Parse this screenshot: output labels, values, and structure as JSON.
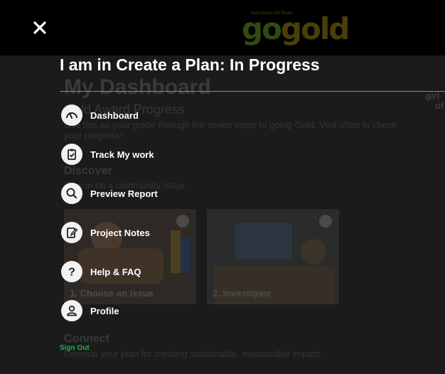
{
  "header": {
    "logo_small_text": "Gold Award Girl Scout",
    "logo_go": "go",
    "logo_gold": "gold",
    "colors": {
      "background": "#000000",
      "close": "#ffffff"
    }
  },
  "background_page": {
    "title": "My Dashboard",
    "subtitle": "Gold Award Progress",
    "intro": "Use this as your guide through the seven steps to going Gold. Visit often to check your progress!",
    "discover_heading": "Discover",
    "discover_text": "Zero in on a community issue.",
    "aside": [
      "girl",
      "of"
    ],
    "cards": [
      {
        "label": "1. Choose an Issue"
      },
      {
        "label": "2. Investigate"
      }
    ],
    "connect_heading": "Connect",
    "connect_text": "Develop your plan for creating sustainable, measurable impact."
  },
  "menu": {
    "title": "I am in Create a Plan: In Progress",
    "items": [
      {
        "label": "Dashboard",
        "icon": "speedometer-icon"
      },
      {
        "label": "Track My work",
        "icon": "clipboard-check-icon"
      },
      {
        "label": "Preview Report",
        "icon": "search-icon"
      },
      {
        "label": "Project Notes",
        "icon": "edit-note-icon"
      },
      {
        "label": "Help & FAQ",
        "icon": "question-icon"
      },
      {
        "label": "Profile",
        "icon": "user-icon"
      }
    ],
    "signout_label": "Sign Out",
    "colors": {
      "accent": "#1fb34a",
      "text": "#ffffff",
      "icon_bg": "#f2f2f2"
    }
  }
}
